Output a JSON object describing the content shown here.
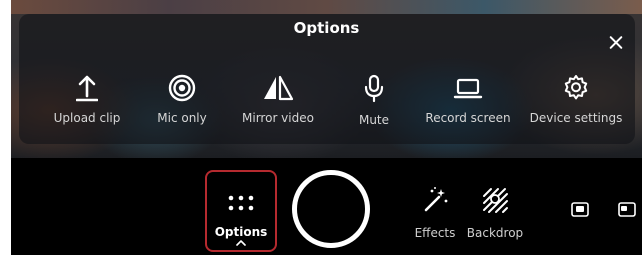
{
  "panel": {
    "title": "Options",
    "close_icon": "close-icon",
    "items": [
      {
        "label": "Upload clip",
        "icon": "upload-icon"
      },
      {
        "label": "Mic only",
        "icon": "mic-only-icon"
      },
      {
        "label": "Mirror video",
        "icon": "mirror-icon"
      },
      {
        "label": "Mute",
        "icon": "microphone-icon"
      },
      {
        "label": "Record screen",
        "icon": "laptop-icon"
      },
      {
        "label": "Device settings",
        "icon": "gear-icon"
      }
    ]
  },
  "toolbar": {
    "options_label": "Options",
    "effects_label": "Effects",
    "backdrop_label": "Backdrop",
    "accent_color": "#b52a2f"
  }
}
